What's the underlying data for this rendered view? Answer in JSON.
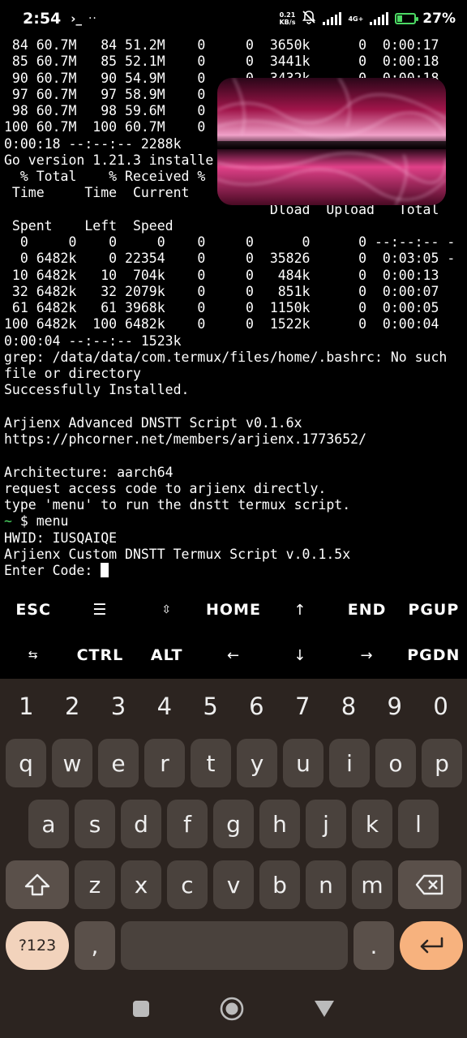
{
  "status_bar": {
    "time": "2:54",
    "term_glyph": "›_",
    "dots": "··",
    "net_speed_value": "0.21",
    "net_speed_unit": "KB/s",
    "network_type": "4G+",
    "battery_percent": "27%",
    "battery_level": 0.27,
    "accent_color": "#4cd964"
  },
  "terminal": {
    "lines": [
      " 84 60.7M   84 51.2M    0     0  3650k      0  0:00:17",
      " 85 60.7M   85 52.1M    0     0  3441k      0  0:00:18",
      " 90 60.7M   90 54.9M    0     0  3432k      0  0:00:18",
      " 97 60.7M   97 58.9M    0     0",
      " 98 60.7M   98 59.6M    0     0",
      "100 60.7M  100 60.7M    0     0",
      "0:00:18 --:--:-- 2288k",
      "Go version 1.21.3 installe",
      "  % Total    % Received %",
      " Time     Time  Current",
      "                                 Dload  Upload   Total",
      " Spent    Left  Speed",
      "  0     0    0     0    0     0      0      0 --:--:-- -",
      "  0 6482k    0 22354    0     0  35826      0  0:03:05 -",
      " 10 6482k   10  704k    0     0   484k      0  0:00:13",
      " 32 6482k   32 2079k    0     0   851k      0  0:00:07",
      " 61 6482k   61 3968k    0     0  1150k      0  0:00:05",
      "100 6482k  100 6482k    0     0  1522k      0  0:00:04",
      "0:00:04 --:--:-- 1523k",
      "grep: /data/data/com.termux/files/home/.bashrc: No such",
      "file or directory",
      "Successfully Installed.",
      "",
      "Arjienx Advanced DNSTT Script v0.1.6x",
      "https://phcorner.net/members/arjienx.1773652/",
      "",
      "Architecture: aarch64",
      "request access code to arjienx directly.",
      "type 'menu' to run the dnstt termux script."
    ],
    "prompt_tilde": "~",
    "prompt_command": " $ menu",
    "after_lines": [
      "HWID: IUSQAIQE",
      "Arjienx Custom DNSTT Termux Script v.0.1.5x"
    ],
    "input_prompt": "Enter Code: "
  },
  "extra_keys": {
    "row1": [
      "ESC",
      "☰",
      "⇳",
      "HOME",
      "↑",
      "END",
      "PGUP"
    ],
    "row2": [
      "⇆",
      "CTRL",
      "ALT",
      "←",
      "↓",
      "→",
      "PGDN"
    ]
  },
  "keyboard": {
    "numbers": [
      "1",
      "2",
      "3",
      "4",
      "5",
      "6",
      "7",
      "8",
      "9",
      "0"
    ],
    "row1": [
      "q",
      "w",
      "e",
      "r",
      "t",
      "y",
      "u",
      "i",
      "o",
      "p"
    ],
    "row2": [
      "a",
      "s",
      "d",
      "f",
      "g",
      "h",
      "j",
      "k",
      "l"
    ],
    "row3": [
      "z",
      "x",
      "c",
      "v",
      "b",
      "n",
      "m"
    ],
    "sym_label": "?123",
    "comma": ",",
    "period": "."
  }
}
